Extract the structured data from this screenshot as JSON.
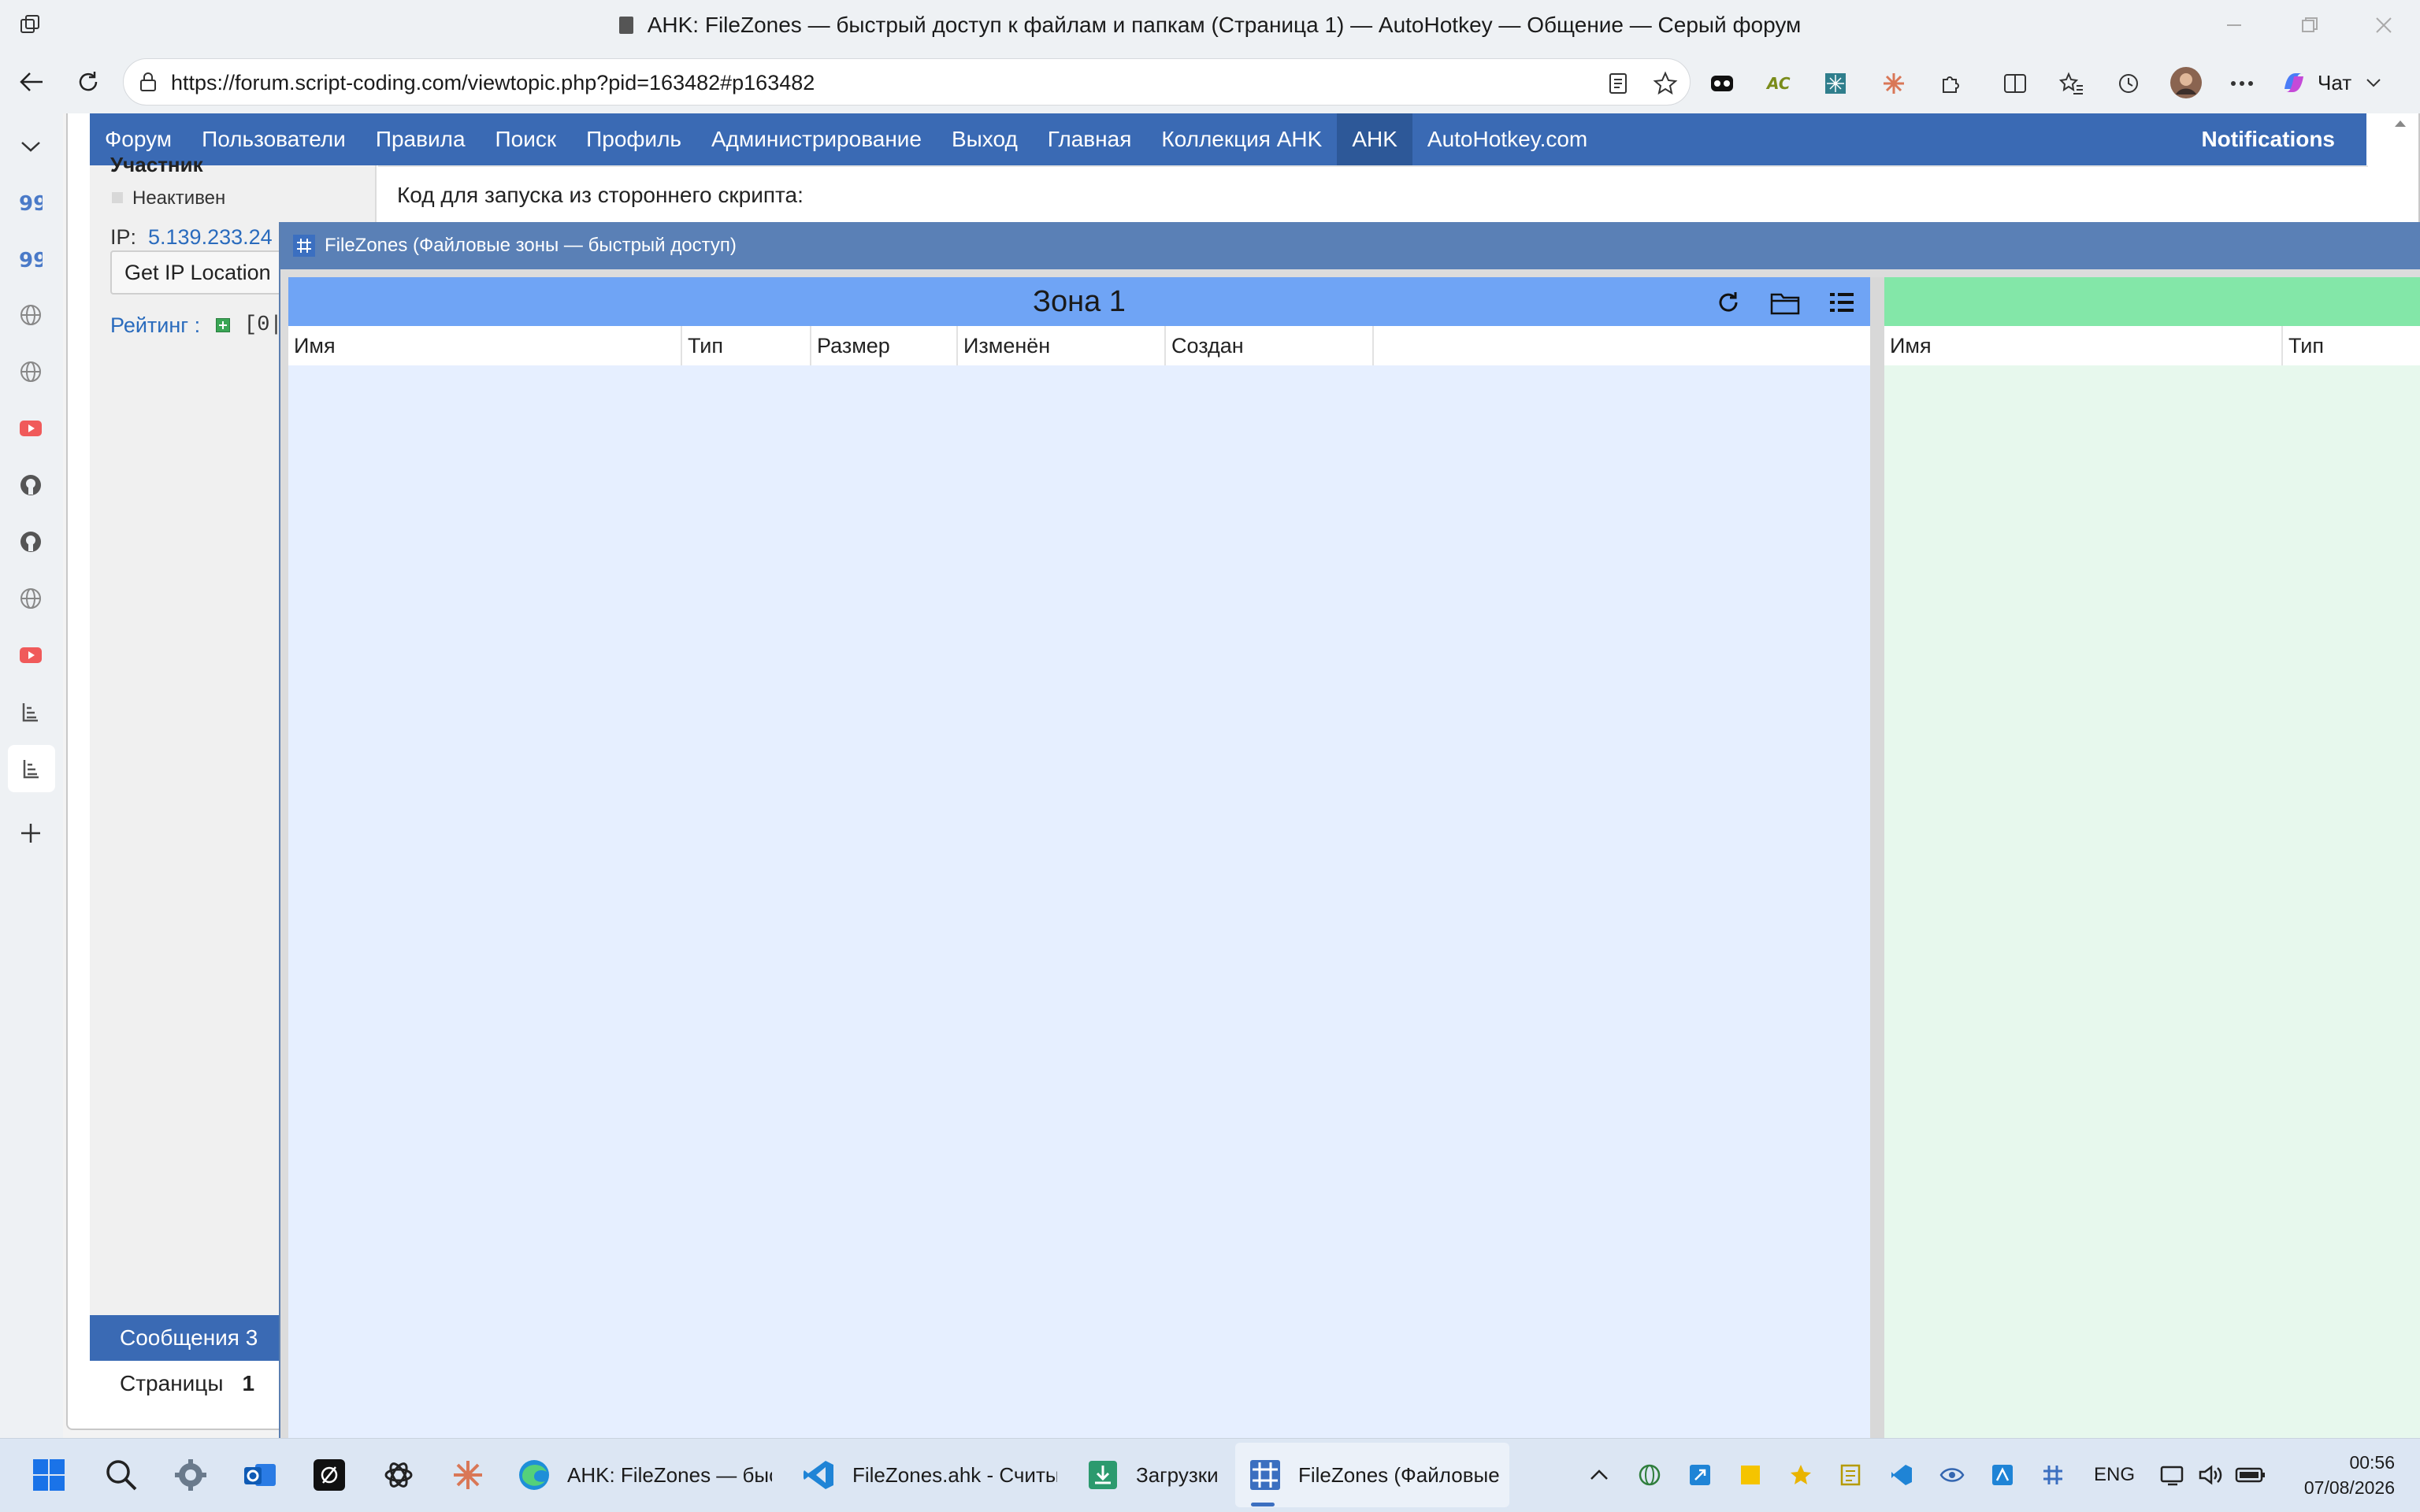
{
  "window": {
    "title": "AHK: FileZones — быстрый доступ к файлам и папкам (Страница 1) — AutoHotkey — Общение — Серый форум"
  },
  "address_bar": {
    "url": "https://forum.script-coding.com/viewtopic.php?pid=163482#p163482"
  },
  "toolbar": {
    "chat_label": "Чат"
  },
  "forum_nav": {
    "items": [
      "Форум",
      "Пользователи",
      "Правила",
      "Поиск",
      "Профиль",
      "Администрирование",
      "Выход",
      "Главная",
      "Коллекция AHK",
      "AHK",
      "AutoHotkey.com"
    ],
    "active_index": 9,
    "notifications": "Notifications"
  },
  "post": {
    "user_role": "Участник",
    "status": "Неактивен",
    "ip_label": "IP:",
    "ip_value": "5.139.233.24",
    "get_ip_button": "Get IP Location",
    "rating_label": "Рейтинг :",
    "rating_value": "[0|",
    "code_caption": "Код для запуска из стороннего скрипта:",
    "messages_label": "Сообщения 3",
    "pages_label": "Страницы",
    "pages_value": "1"
  },
  "filezones": {
    "window_title": "FileZones (Файловые зоны — быстрый доступ)",
    "zone1": {
      "title": "Зона 1",
      "columns": [
        "Имя",
        "Тип",
        "Размер",
        "Изменён",
        "Создан"
      ],
      "header_color": "#6fa4f5",
      "body_color": "#e6efff"
    },
    "zone2": {
      "title": "",
      "columns": [
        "Имя",
        "Тип"
      ],
      "header_color": "#83e7a8",
      "body_color": "#e7f8ed"
    }
  },
  "taskbar": {
    "apps": [
      {
        "label": "AHK: FileZones — быстр",
        "icon": "edge-icon"
      },
      {
        "label": "FileZones.ahk - Считыв",
        "icon": "vscode-icon"
      },
      {
        "label": "Загрузки",
        "icon": "downloads-icon"
      },
      {
        "label": "FileZones (Файловые зо",
        "icon": "filezones-icon"
      }
    ],
    "language": "ENG",
    "time": "00:56",
    "date": "07/08/2026"
  },
  "colors": {
    "forum_nav": "#3a6ab4",
    "filezones_title": "#5a80b6",
    "taskbar": "#dce6f3"
  }
}
